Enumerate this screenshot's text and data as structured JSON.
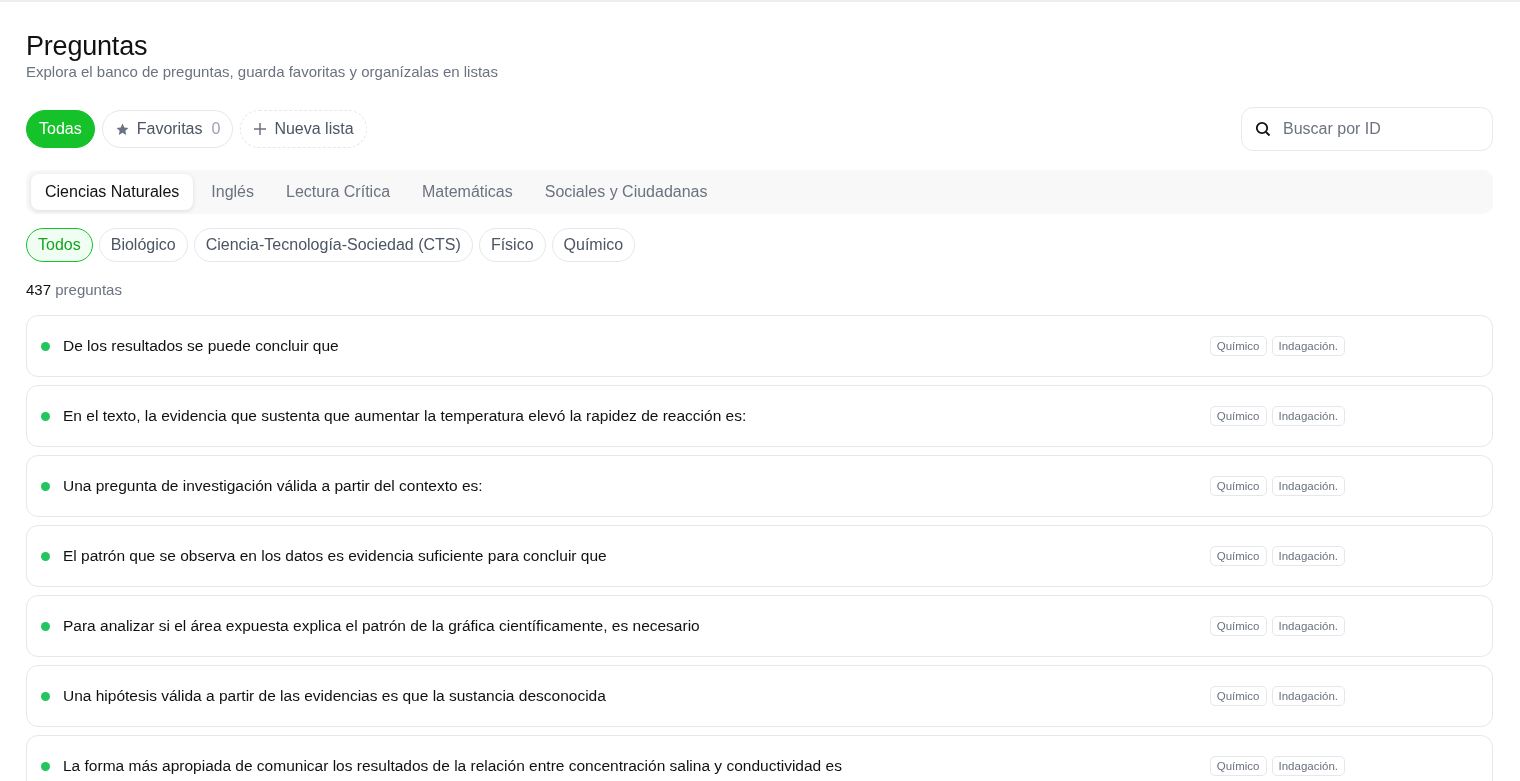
{
  "header": {
    "title": "Preguntas",
    "subtitle": "Explora el banco de preguntas, guarda favoritas y organízalas en listas"
  },
  "lists": [
    {
      "kind": "all",
      "label": "Todas",
      "selected": true
    },
    {
      "kind": "favorites",
      "label": "Favoritas",
      "count": "0",
      "selected": false
    },
    {
      "kind": "new",
      "label": "Nueva lista",
      "selected": false
    }
  ],
  "search": {
    "placeholder": "Buscar por ID"
  },
  "subjects": [
    {
      "label": "Ciencias Naturales",
      "selected": true
    },
    {
      "label": "Inglés",
      "selected": false
    },
    {
      "label": "Lectura Crítica",
      "selected": false
    },
    {
      "label": "Matemáticas",
      "selected": false
    },
    {
      "label": "Sociales y Ciudadanas",
      "selected": false
    }
  ],
  "components": [
    {
      "label": "Todos",
      "selected": true
    },
    {
      "label": "Biológico",
      "selected": false
    },
    {
      "label": "Ciencia-Tecnología-Sociedad (CTS)",
      "selected": false
    },
    {
      "label": "Físico",
      "selected": false
    },
    {
      "label": "Químico",
      "selected": false
    }
  ],
  "count": {
    "number": "437",
    "label": "preguntas"
  },
  "questions": [
    {
      "text": "De los resultados se puede concluir que",
      "color": "#22c55e",
      "tags": [
        "Químico",
        "Indagación."
      ]
    },
    {
      "text": "En el texto, la evidencia que sustenta que aumentar la temperatura elevó la rapidez de reacción es:",
      "color": "#22c55e",
      "tags": [
        "Químico",
        "Indagación."
      ]
    },
    {
      "text": "Una pregunta de investigación válida a partir del contexto es:",
      "color": "#22c55e",
      "tags": [
        "Químico",
        "Indagación."
      ]
    },
    {
      "text": "El patrón que se observa en los datos es evidencia suficiente para concluir que",
      "color": "#22c55e",
      "tags": [
        "Químico",
        "Indagación."
      ]
    },
    {
      "text": "Para analizar si el área expuesta explica el patrón de la gráfica científicamente, es necesario",
      "color": "#22c55e",
      "tags": [
        "Químico",
        "Indagación."
      ]
    },
    {
      "text": "Una hipótesis válida a partir de las evidencias es que la sustancia desconocida",
      "color": "#22c55e",
      "tags": [
        "Químico",
        "Indagación."
      ]
    },
    {
      "text": "La forma más apropiada de comunicar los resultados de la relación entre concentración salina y conductividad es",
      "color": "#22c55e",
      "tags": [
        "Químico",
        "Indagación."
      ]
    }
  ]
}
